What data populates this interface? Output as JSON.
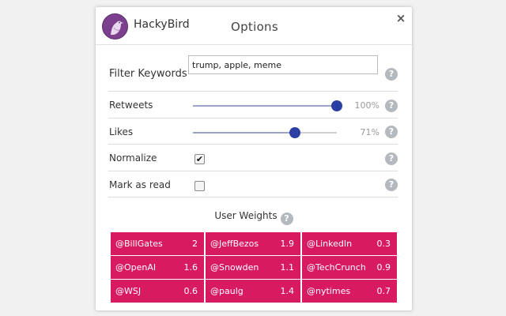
{
  "header": {
    "app_name": "HackyBird",
    "title": "Options",
    "close_label": "×"
  },
  "filter": {
    "label": "Filter Keywords",
    "value": "trump, apple, meme"
  },
  "retweets": {
    "label": "Retweets",
    "percent": 100,
    "percent_text": "100%"
  },
  "likes": {
    "label": "Likes",
    "percent": 71,
    "percent_text": "71%"
  },
  "normalize": {
    "label": "Normalize",
    "checked": true,
    "mark": "✔"
  },
  "mark_read": {
    "label": "Mark as read",
    "checked": false
  },
  "help_glyph": "?",
  "user_weights": {
    "title": "User Weights",
    "rows": [
      [
        {
          "handle": "@BillGates",
          "weight": "2"
        },
        {
          "handle": "@JeffBezos",
          "weight": "1.9"
        },
        {
          "handle": "@LinkedIn",
          "weight": "0.3"
        }
      ],
      [
        {
          "handle": "@OpenAI",
          "weight": "1.6"
        },
        {
          "handle": "@Snowden",
          "weight": "1.1"
        },
        {
          "handle": "@TechCrunch",
          "weight": "0.9"
        }
      ],
      [
        {
          "handle": "@WSJ",
          "weight": "0.6"
        },
        {
          "handle": "@paulg",
          "weight": "1.4"
        },
        {
          "handle": "@nytimes",
          "weight": "0.7"
        }
      ]
    ]
  },
  "colors": {
    "accent": "#2b3fa3",
    "cell_bg": "#d81b60",
    "logo_bg": "#7b3f8e"
  },
  "icons": {
    "logo": "bird-icon",
    "close": "close-icon",
    "help": "help-icon",
    "check": "check-icon"
  }
}
